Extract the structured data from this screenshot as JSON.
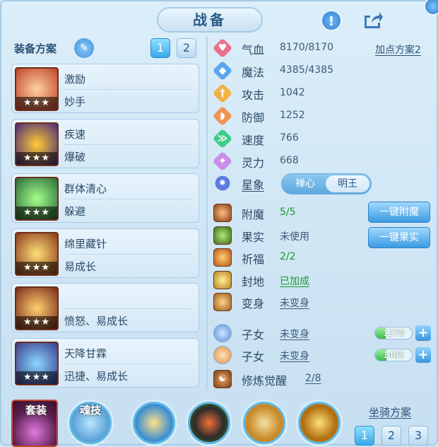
{
  "header": {
    "title": "战备",
    "help_icon": "!",
    "share_icon": "share-icon"
  },
  "left": {
    "scheme_label": "装备方案",
    "scheme_buttons": [
      "1",
      "2"
    ],
    "skills": [
      {
        "name": "激励",
        "sub": "妙手",
        "stars": "★★★"
      },
      {
        "name": "疾速",
        "sub": "爆破",
        "stars": "★★★"
      },
      {
        "name": "群体清心",
        "sub": "躲避",
        "stars": "★★★"
      },
      {
        "name": "绵里藏针",
        "sub": "易成长",
        "stars": "★★★"
      },
      {
        "name": "",
        "sub": "愤怒、易成长",
        "stars": "★★★"
      },
      {
        "name": "天降甘霖",
        "sub": "迅捷、易成长",
        "stars": "★★★"
      }
    ]
  },
  "stats": [
    {
      "name": "气血",
      "value": "8170/8170",
      "color": "#e8708e",
      "glyph": "♥"
    },
    {
      "name": "魔法",
      "value": "4385/4385",
      "color": "#5aa6ec",
      "glyph": "◆"
    },
    {
      "name": "攻击",
      "value": "1042",
      "color": "#f1b243",
      "glyph": "†"
    },
    {
      "name": "防御",
      "value": "1252",
      "color": "#ee9552",
      "glyph": "◗"
    },
    {
      "name": "速度",
      "value": "766",
      "color": "#3dcc8a",
      "glyph": "≫"
    },
    {
      "name": "灵力",
      "value": "668",
      "color": "#c98ee8",
      "glyph": "✦"
    }
  ],
  "point_plan": "加点方案2",
  "constellation": {
    "label": "星象",
    "options": [
      "禅心",
      "明王"
    ],
    "selected": "明王"
  },
  "enhance": [
    {
      "name": "附魔",
      "value": "5/5",
      "value_color": "#1a9a2c",
      "button": "一键附魔"
    },
    {
      "name": "果实",
      "value": "未使用",
      "value_color": "#3c5a78",
      "button": "一键果实"
    },
    {
      "name": "祈福",
      "value": "2/2",
      "value_color": "#1a9a2c"
    },
    {
      "name": "封地",
      "value": "已加成",
      "value_color": "#1a9a2c"
    },
    {
      "name": "变身",
      "value": "未变身",
      "value_color": "#3c5a78"
    }
  ],
  "children": [
    {
      "name": "子女",
      "value": "未变身",
      "bar_value": "1270",
      "bar_fraction": 0.28
    },
    {
      "name": "子女",
      "value": "未变身",
      "bar_value": "1405",
      "bar_fraction": 0.3
    }
  ],
  "awaken": {
    "name": "修炼觉醒",
    "value": "2/8"
  },
  "bottom": {
    "set_label": "套装",
    "soul_label": "魂技",
    "mount_label": "坐骑方案",
    "mount_buttons": [
      "1",
      "2",
      "3"
    ]
  },
  "colors": {
    "accent": "#36a9e8",
    "green": "#1a9a2c",
    "panel": "#d4e8f6"
  }
}
